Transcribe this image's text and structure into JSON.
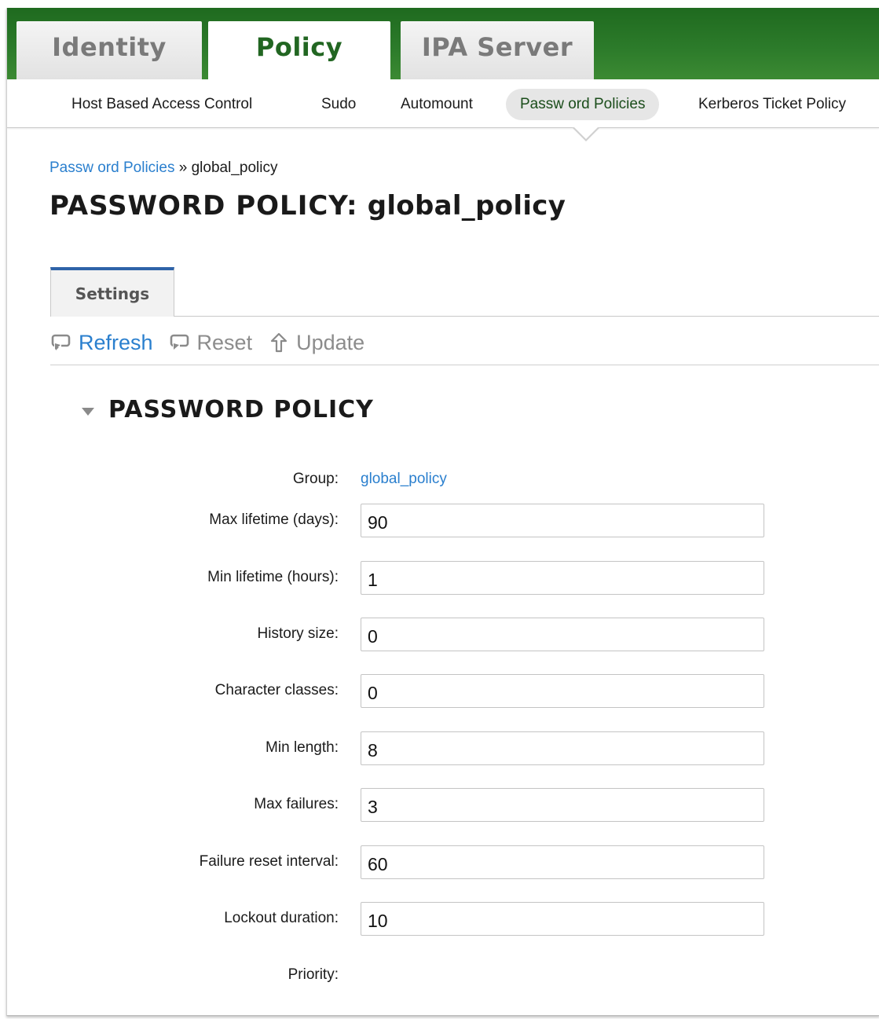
{
  "nav": {
    "tabs": [
      {
        "label": "Identity"
      },
      {
        "label": "Policy"
      },
      {
        "label": "IPA Server"
      }
    ],
    "active_tab": "Policy"
  },
  "subnav": {
    "items": [
      {
        "label": "Host Based Access Control"
      },
      {
        "label": "Sudo"
      },
      {
        "label": "Automount"
      },
      {
        "label": "Passw ord Policies"
      },
      {
        "label": "Kerberos Ticket Policy"
      }
    ],
    "active_item": "Passw ord Policies"
  },
  "breadcrumb": {
    "parent": "Passw ord Policies",
    "separator": "»",
    "current": "global_policy"
  },
  "page": {
    "title_label": "PASSWORD POLICY:",
    "title_value": "global_policy"
  },
  "content_tabs": [
    {
      "label": "Settings"
    }
  ],
  "actions": {
    "refresh": "Refresh",
    "reset": "Reset",
    "update": "Update"
  },
  "section": {
    "title": "PASSWORD POLICY"
  },
  "form": {
    "group_label": "Group:",
    "group_value": "global_policy",
    "fields": [
      {
        "label": "Max lifetime (days):",
        "value": "90"
      },
      {
        "label": "Min lifetime (hours):",
        "value": "1"
      },
      {
        "label": "History size:",
        "value": "0"
      },
      {
        "label": "Character classes:",
        "value": "0"
      },
      {
        "label": "Min length:",
        "value": "8"
      },
      {
        "label": "Max failures:",
        "value": "3"
      },
      {
        "label": "Failure reset interval:",
        "value": "60"
      },
      {
        "label": "Lockout duration:",
        "value": "10"
      }
    ],
    "priority_label": "Priority:"
  },
  "colors": {
    "header_green": "#2d7c2b",
    "active_tab_text": "#226622",
    "link_blue": "#2a7fce",
    "settings_tab_border": "#2e63a8"
  },
  "icons": {
    "refresh": "refresh-icon",
    "reset": "reset-icon",
    "update": "update-arrow-icon",
    "section_toggle": "triangle-down-icon"
  }
}
